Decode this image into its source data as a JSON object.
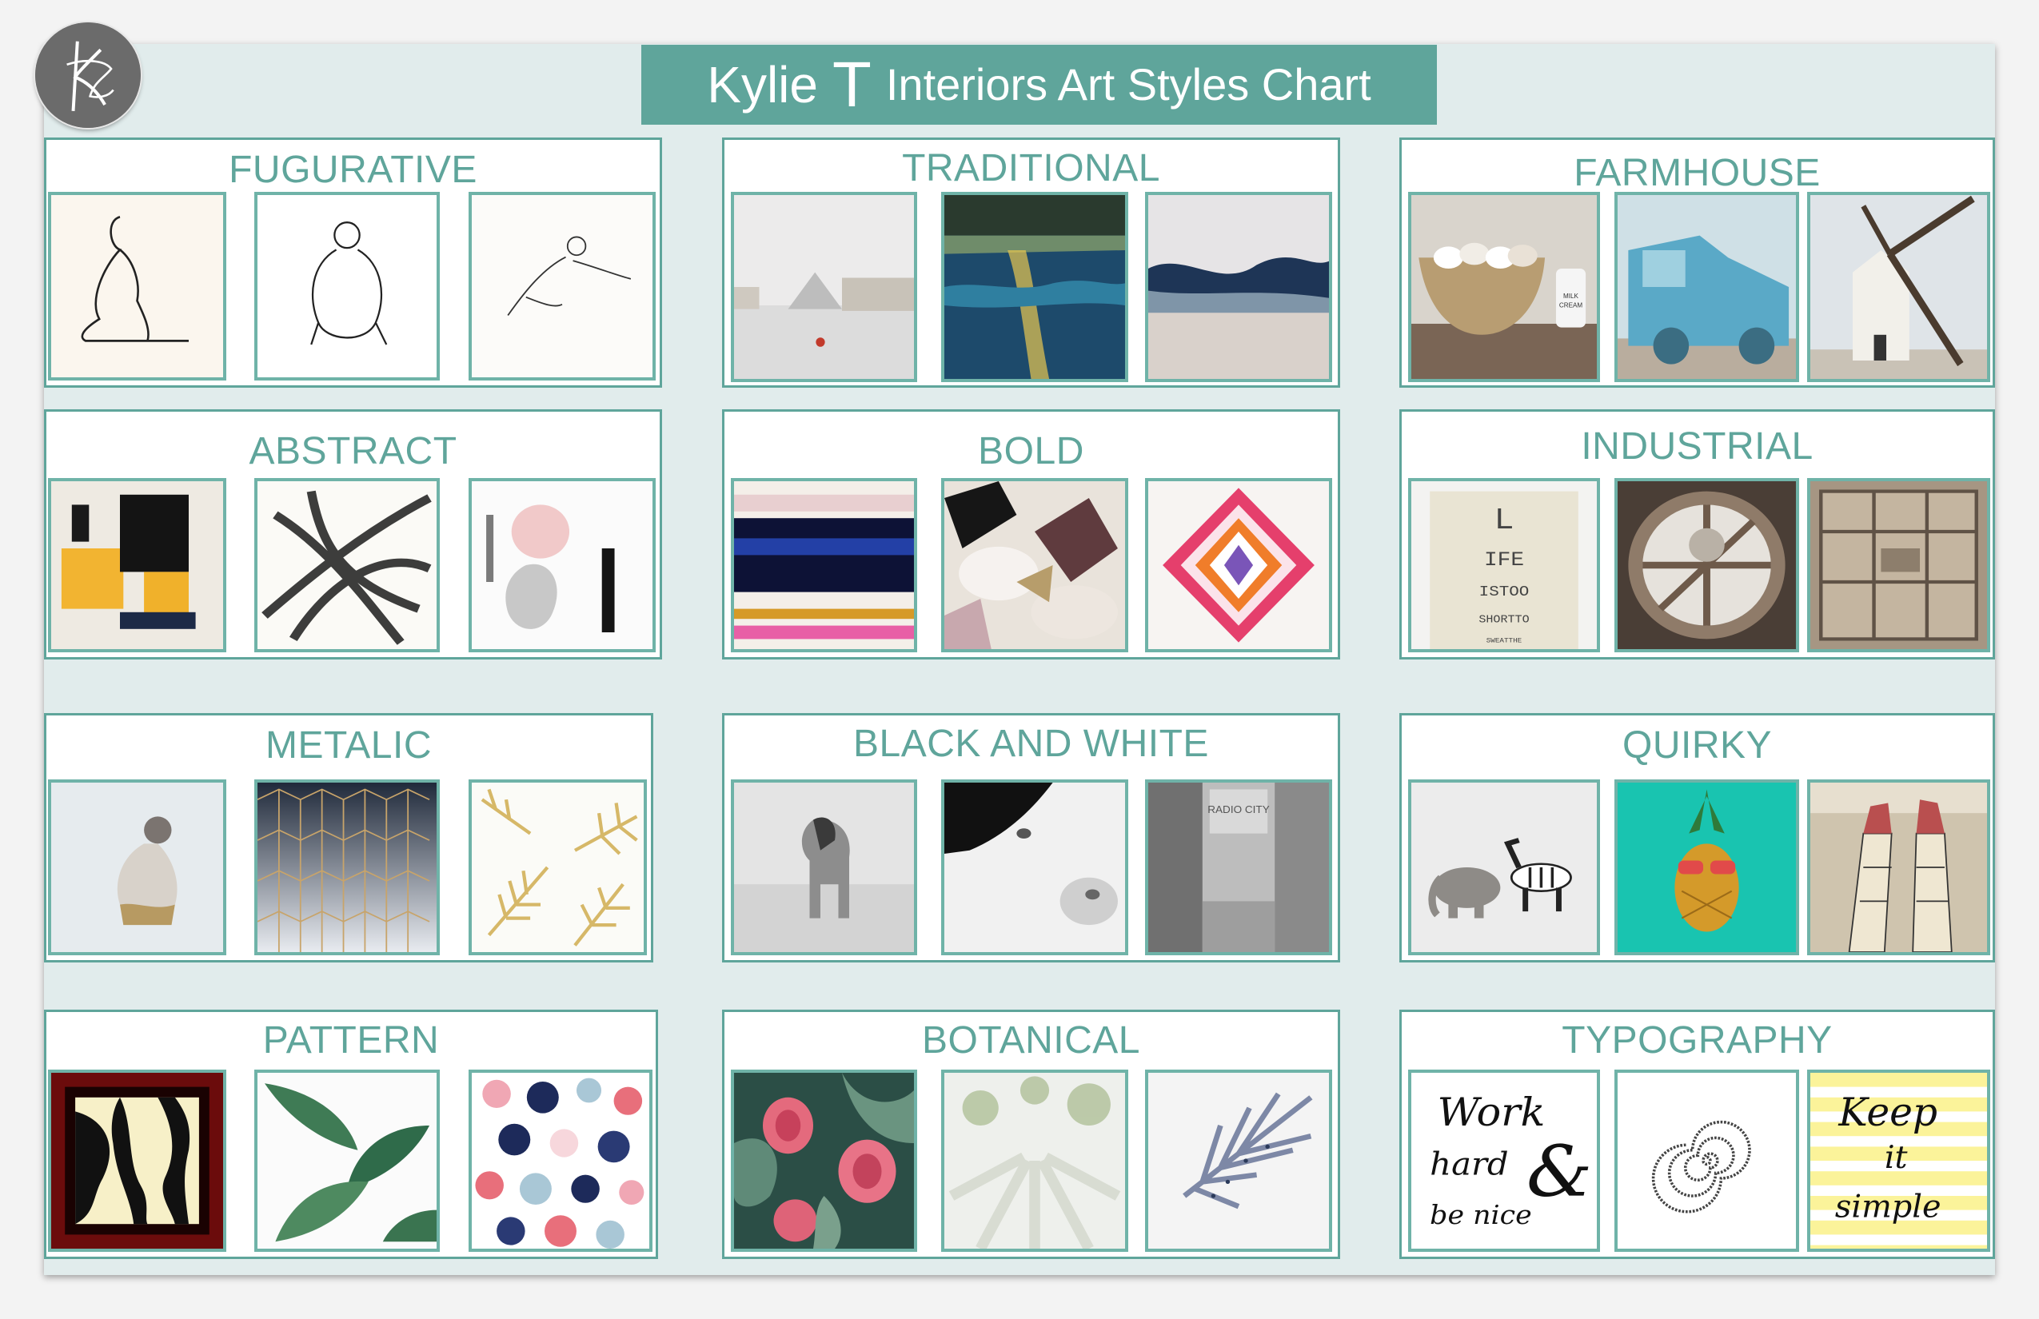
{
  "header": {
    "brand_initial_1": "Kylie",
    "brand_initial_2": "T",
    "subtitle": "Interiors Art Styles Chart",
    "logo_alt": "KT monogram logo"
  },
  "colors": {
    "accent": "#5fa59b",
    "board": "#e1ecec",
    "thumb_border": "#6fb3a8"
  },
  "categories": [
    {
      "id": "figurative",
      "label": "FUGURATIVE",
      "thumbs": [
        "seated-figure-sketch",
        "back-figure-sketch",
        "reclining-figure-sketch"
      ]
    },
    {
      "id": "traditional",
      "label": "TRADITIONAL",
      "thumbs": [
        "louvre-pyramid-painting",
        "night-water-painting",
        "abstract-landscape-painting"
      ]
    },
    {
      "id": "farmhouse",
      "label": "FARMHOUSE",
      "thumbs": [
        "eggs-bowl-photo",
        "blue-truck-photo",
        "windmill-photo"
      ]
    },
    {
      "id": "abstract",
      "label": "ABSTRACT",
      "thumbs": [
        "yellow-black-abstract",
        "black-brushstroke-abstract",
        "watercolor-abstract"
      ]
    },
    {
      "id": "bold",
      "label": "BOLD",
      "thumbs": [
        "color-band-painting",
        "brushstroke-floral",
        "agate-pattern"
      ]
    },
    {
      "id": "industrial",
      "label": "INDUSTRIAL",
      "thumbs": [
        "eye-chart-typography",
        "industrial-fan",
        "shipping-container"
      ]
    },
    {
      "id": "metalic",
      "label": "METALIC",
      "thumbs": [
        "gold-figure-painting",
        "geometric-cube-pattern",
        "gold-palm-leaves"
      ]
    },
    {
      "id": "black-and-white",
      "label": "BLACK AND WHITE",
      "thumbs": [
        "horse-photo",
        "cow-closeup-photo",
        "city-street-photo"
      ]
    },
    {
      "id": "quirky",
      "label": "QUIRKY",
      "thumbs": [
        "elephant-zebra-toys",
        "pineapple-sunglasses",
        "legs-in-boots"
      ]
    },
    {
      "id": "pattern",
      "label": "PATTERN",
      "thumbs": [
        "zebra-print",
        "banana-leaf-print",
        "dot-pattern"
      ]
    },
    {
      "id": "botanical",
      "label": "BOTANICAL",
      "thumbs": [
        "protea-print",
        "birch-trees-photo",
        "feather-leaf-print"
      ]
    },
    {
      "id": "typography",
      "label": "TYPOGRAPHY",
      "thumbs": [
        "work-hard-be-nice",
        "spiral-text",
        "keep-it-simple"
      ]
    }
  ],
  "thumb_text": {
    "eye_chart": [
      "L",
      "IFE",
      "ISTOO",
      "SHORTTO",
      "SWEATTHE"
    ],
    "work_hard": [
      "Work",
      "hard",
      "&",
      "be nice"
    ],
    "keep_simple": [
      "Keep",
      "it",
      "simple"
    ],
    "milk_jar": [
      "MILK",
      "CREAM"
    ],
    "radio_city": "RADIO CITY"
  }
}
